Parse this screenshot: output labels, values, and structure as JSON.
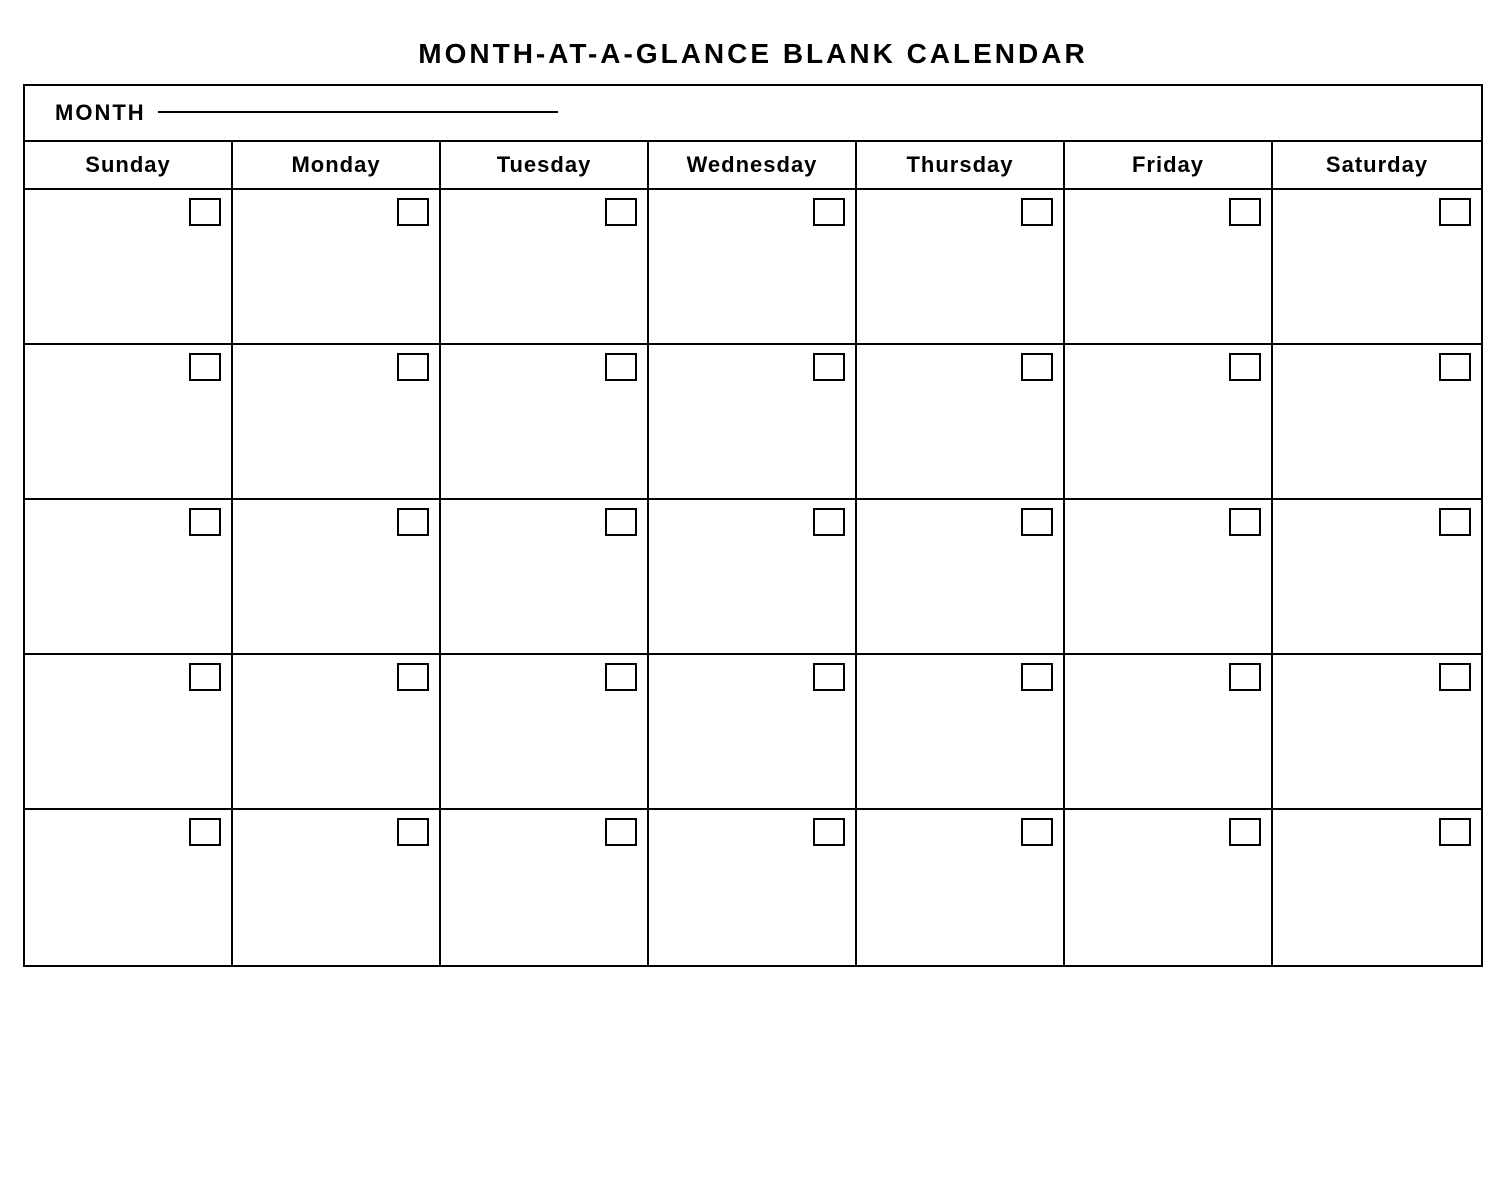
{
  "title": "MONTH-AT-A-GLANCE  BLANK  CALENDAR",
  "month_label": "MONTH",
  "days": [
    {
      "label": "Sunday"
    },
    {
      "label": "Monday"
    },
    {
      "label": "Tuesday"
    },
    {
      "label": "Wednesday"
    },
    {
      "label": "Thursday"
    },
    {
      "label": "Friday"
    },
    {
      "label": "Saturday"
    }
  ],
  "num_weeks": 5
}
